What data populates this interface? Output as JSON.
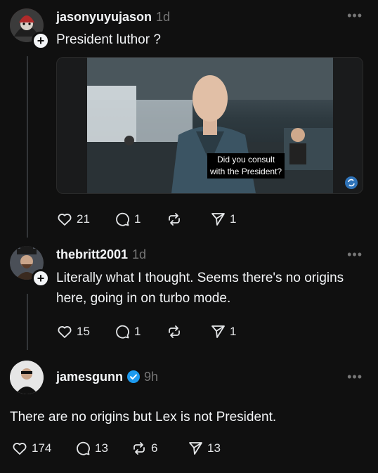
{
  "posts": [
    {
      "username": "jasonyuyujason",
      "time": "1d",
      "text": "President luthor ?",
      "media": {
        "caption_line1": "Did you consult",
        "caption_line2": "with the President?"
      },
      "likes": "21",
      "replies": "1",
      "reposts": "",
      "shares": "1"
    },
    {
      "username": "thebritt2001",
      "time": "1d",
      "text_line1": "Literally what I thought. Seems there's no origins",
      "text_line2": "here, going in on turbo mode.",
      "likes": "15",
      "replies": "1",
      "reposts": "",
      "shares": "1"
    },
    {
      "username": "jamesgunn",
      "time": "9h",
      "verified": true,
      "text": "There are no origins but Lex is not President.",
      "likes": "174",
      "replies": "13",
      "reposts": "6",
      "shares": "13"
    }
  ],
  "icons": {
    "like": "heart-icon",
    "reply": "comment-icon",
    "repost": "repost-icon",
    "share": "send-icon",
    "more": "more-dots-icon"
  },
  "colors": {
    "background": "#101010",
    "text": "#f3f5f7",
    "muted": "#777777",
    "verified": "#1d9bf0"
  }
}
